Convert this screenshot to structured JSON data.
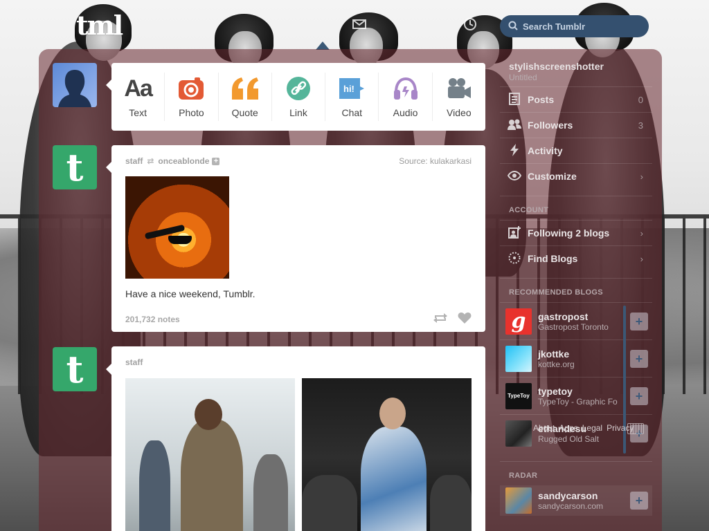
{
  "header": {
    "logo_text": "tml",
    "search_placeholder": "Search Tumblr"
  },
  "post_types": [
    {
      "label": "Text",
      "icon": "text-icon",
      "color": "#444444"
    },
    {
      "label": "Photo",
      "icon": "camera-icon",
      "color": "#e35a35"
    },
    {
      "label": "Quote",
      "icon": "quote-icon",
      "color": "#f2992e"
    },
    {
      "label": "Link",
      "icon": "link-icon",
      "color": "#55b59a"
    },
    {
      "label": "Chat",
      "icon": "chat-icon",
      "color": "#5aa0d8"
    },
    {
      "label": "Audio",
      "icon": "headphones-icon",
      "color": "#a886c8"
    },
    {
      "label": "Video",
      "icon": "video-camera-icon",
      "color": "#748089"
    }
  ],
  "posts": [
    {
      "author": "staff",
      "reblogged_from": "onceablonde",
      "source": "Source: kulakarkasi",
      "caption": "Have a nice weekend, Tumblr.",
      "notes": "201,732 notes"
    },
    {
      "author": "staff"
    }
  ],
  "sidebar": {
    "blog_title": "stylishscreenshotter",
    "blog_subtitle": "Untitled",
    "rows": [
      {
        "label": "Posts",
        "end": "0",
        "icon": "posts-icon"
      },
      {
        "label": "Followers",
        "end": "3",
        "icon": "followers-icon"
      },
      {
        "label": "Activity",
        "end": "",
        "icon": "lightning-icon"
      },
      {
        "label": "Customize",
        "end": "›",
        "icon": "eye-icon"
      }
    ],
    "account_heading": "ACCOUNT",
    "account_rows": [
      {
        "label": "Following 2 blogs",
        "end": "›",
        "icon": "following-icon"
      },
      {
        "label": "Find Blogs",
        "end": "›",
        "icon": "compass-icon"
      }
    ],
    "recommended_heading": "RECOMMENDED BLOGS",
    "recommended": [
      {
        "name": "gastropost",
        "subtitle": "Gastropost Toronto",
        "thumb_color": "#e8322d"
      },
      {
        "name": "jkottke",
        "subtitle": "kottke.org",
        "thumb_color": "#3fc8f2"
      },
      {
        "name": "typetoy",
        "subtitle": "TypeToy - Graphic Fo",
        "thumb_color": "#111111"
      },
      {
        "name": "ethandesu",
        "subtitle": "Rugged Old Salt",
        "thumb_color": "#444444"
      }
    ],
    "footer_links": [
      "About",
      "Apps",
      "Legal",
      "Privacy"
    ],
    "radar_heading": "RADAR",
    "radar": {
      "name": "sandycarson",
      "subtitle": "sandycarson.com"
    }
  },
  "colors": {
    "panel_overlay": "#682830",
    "search_bg": "#34506f",
    "tumblr_green": "#35a76b"
  }
}
